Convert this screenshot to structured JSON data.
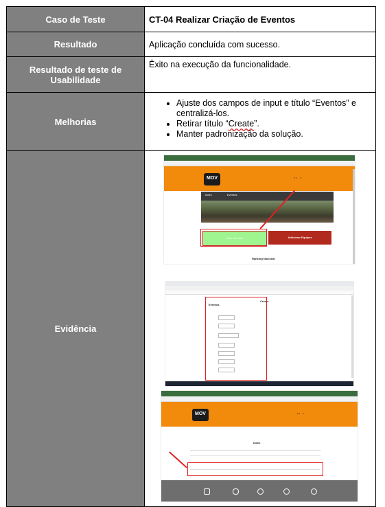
{
  "rows": {
    "caso_label": "Caso de Teste",
    "caso_value": "CT-04 Realizar Criação de Eventos",
    "resultado_label": "Resultado",
    "resultado_value": "Aplicação concluída com sucesso.",
    "usab_label": "Resultado de teste de Usabilidade",
    "usab_value": "Êxito na execução da funcionalidade.",
    "melhorias_label": "Melhorias",
    "melhorias": {
      "item1": "Ajuste dos campos de input e título “Eventos” e centralizá-los.",
      "item2_prefix": "Retirar título “",
      "item2_word": "Create",
      "item2_suffix": "”.",
      "item3": "Manter padronização da solução."
    },
    "evidencia_label": "Evidência"
  },
  "evidence": {
    "shot1": {
      "nav_left": "Index",
      "nav_right": "Eventos",
      "button_green": "Criar Eventos",
      "button_red": "Adicionar Equipes",
      "section_title": "Ranking Nacional",
      "logo": "MOV"
    },
    "shot2": {
      "title_create": "Create",
      "title_eventos": "Eventos"
    },
    "shot3": {
      "section_title": "Index",
      "logo": "MOV"
    }
  },
  "colors": {
    "label_bg": "#808080",
    "site_orange": "#f28a0c",
    "highlight_red": "#e02020"
  }
}
